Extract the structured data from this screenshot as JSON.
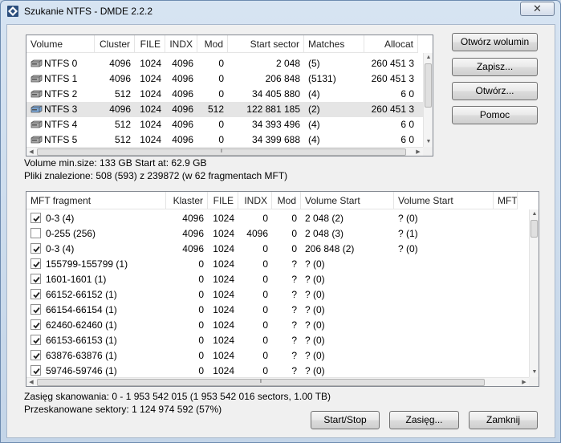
{
  "window": {
    "title": "Szukanie NTFS - DMDE 2.2.2",
    "close_glyph": "✕"
  },
  "volumes": {
    "columns": [
      "Volume",
      "Cluster",
      "FILE",
      "INDX",
      "Mod",
      "Start sector",
      "Matches",
      "Allocat"
    ],
    "rows": [
      {
        "volume": "NTFS 0",
        "cluster": "4096",
        "file": "1024",
        "indx": "4096",
        "mod": "0",
        "start": "2 048",
        "matches": "(5)",
        "alloc": "260 451 3",
        "selected": false,
        "icon": "hdd-icon"
      },
      {
        "volume": "NTFS 1",
        "cluster": "4096",
        "file": "1024",
        "indx": "4096",
        "mod": "0",
        "start": "206 848",
        "matches": "(5131)",
        "alloc": "260 451 3",
        "selected": false,
        "icon": "hdd-icon"
      },
      {
        "volume": "NTFS 2",
        "cluster": "512",
        "file": "1024",
        "indx": "4096",
        "mod": "0",
        "start": "34 405 880",
        "matches": "(4)",
        "alloc": "6 0",
        "selected": false,
        "icon": "hdd-icon"
      },
      {
        "volume": "NTFS 3",
        "cluster": "4096",
        "file": "1024",
        "indx": "4096",
        "mod": "512",
        "start": "122 881 185",
        "matches": "(2)",
        "alloc": "260 451 3",
        "selected": true,
        "icon": "hdd-blue-icon"
      },
      {
        "volume": "NTFS 4",
        "cluster": "512",
        "file": "1024",
        "indx": "4096",
        "mod": "0",
        "start": "34 393 496",
        "matches": "(4)",
        "alloc": "6 0",
        "selected": false,
        "icon": "hdd-icon"
      },
      {
        "volume": "NTFS 5",
        "cluster": "512",
        "file": "1024",
        "indx": "4096",
        "mod": "0",
        "start": "34 399 688",
        "matches": "(4)",
        "alloc": "6 0",
        "selected": false,
        "icon": "hdd-icon"
      }
    ]
  },
  "buttons": {
    "open_volume": "Otwórz wolumin",
    "save": "Zapisz...",
    "open": "Otwórz...",
    "help": "Pomoc",
    "start_stop": "Start/Stop",
    "range": "Zasięg...",
    "close": "Zamknij"
  },
  "info": {
    "volume_min": "Volume min.size: 133 GB Start at: 62.9 GB",
    "files_found": "Pliki znalezione: 508 (593) z 239872 (w 62 fragmentach MFT)",
    "scan_range": "Zasięg skanowania: 0 - 1 953 542 015 (1 953 542 016 sectors, 1.00 TB)",
    "scanned": "Przeskanowane sektory: 1 124 974 592 (57%)"
  },
  "fragments": {
    "columns": [
      "MFT fragment",
      "Klaster",
      "FILE",
      "INDX",
      "Mod",
      "Volume Start",
      "Volume Start",
      "MFT"
    ],
    "rows": [
      {
        "checked": true,
        "name": "0-3 (4)",
        "klaster": "4096",
        "file": "1024",
        "indx": "0",
        "mod": "0",
        "vs1": "2 048 (2)",
        "vs2": "? (0)"
      },
      {
        "checked": false,
        "name": "0-255 (256)",
        "klaster": "4096",
        "file": "1024",
        "indx": "4096",
        "mod": "0",
        "vs1": "2 048 (3)",
        "vs2": "? (1)"
      },
      {
        "checked": true,
        "name": "0-3 (4)",
        "klaster": "4096",
        "file": "1024",
        "indx": "0",
        "mod": "0",
        "vs1": "206 848 (2)",
        "vs2": "? (0)"
      },
      {
        "checked": true,
        "name": "155799-155799 (1)",
        "klaster": "0",
        "file": "1024",
        "indx": "0",
        "mod": "?",
        "vs1": "? (0)",
        "vs2": ""
      },
      {
        "checked": true,
        "name": "1601-1601 (1)",
        "klaster": "0",
        "file": "1024",
        "indx": "0",
        "mod": "?",
        "vs1": "? (0)",
        "vs2": ""
      },
      {
        "checked": true,
        "name": "66152-66152 (1)",
        "klaster": "0",
        "file": "1024",
        "indx": "0",
        "mod": "?",
        "vs1": "? (0)",
        "vs2": ""
      },
      {
        "checked": true,
        "name": "66154-66154 (1)",
        "klaster": "0",
        "file": "1024",
        "indx": "0",
        "mod": "?",
        "vs1": "? (0)",
        "vs2": ""
      },
      {
        "checked": true,
        "name": "62460-62460 (1)",
        "klaster": "0",
        "file": "1024",
        "indx": "0",
        "mod": "?",
        "vs1": "? (0)",
        "vs2": ""
      },
      {
        "checked": true,
        "name": "66153-66153 (1)",
        "klaster": "0",
        "file": "1024",
        "indx": "0",
        "mod": "?",
        "vs1": "? (0)",
        "vs2": ""
      },
      {
        "checked": true,
        "name": "63876-63876 (1)",
        "klaster": "0",
        "file": "1024",
        "indx": "0",
        "mod": "?",
        "vs1": "? (0)",
        "vs2": ""
      },
      {
        "checked": true,
        "name": "59746-59746 (1)",
        "klaster": "0",
        "file": "1024",
        "indx": "0",
        "mod": "?",
        "vs1": "? (0)",
        "vs2": ""
      }
    ]
  }
}
